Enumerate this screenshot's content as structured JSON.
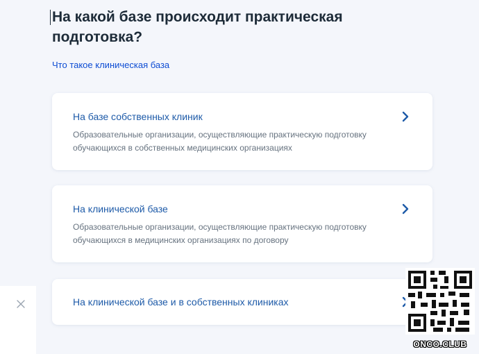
{
  "page": {
    "title": "На какой базе происходит практическая подготовка?",
    "help_link": "Что такое клиническая база"
  },
  "options": [
    {
      "title": "На базе собственных клиник",
      "description": "Образовательные организации, осуществляющие практическую подготовку обучающихся в собственных медицинских организациях"
    },
    {
      "title": "На клинической базе",
      "description": "Образовательные организации, осуществляющие практическую подготовку обучающихся в медицинских организациях по договору"
    },
    {
      "title": "На клинической базе и в собственных клиниках",
      "description": ""
    }
  ],
  "watermark": "ONCO.CLUB",
  "icons": {
    "option_arrow": "chevron-right-icon",
    "close": "close-icon"
  },
  "colors": {
    "background": "#f4f6fb",
    "link": "#0d4cd3",
    "option_title": "#1d5aa8",
    "description": "#66727f",
    "heading": "#1d2b38"
  }
}
